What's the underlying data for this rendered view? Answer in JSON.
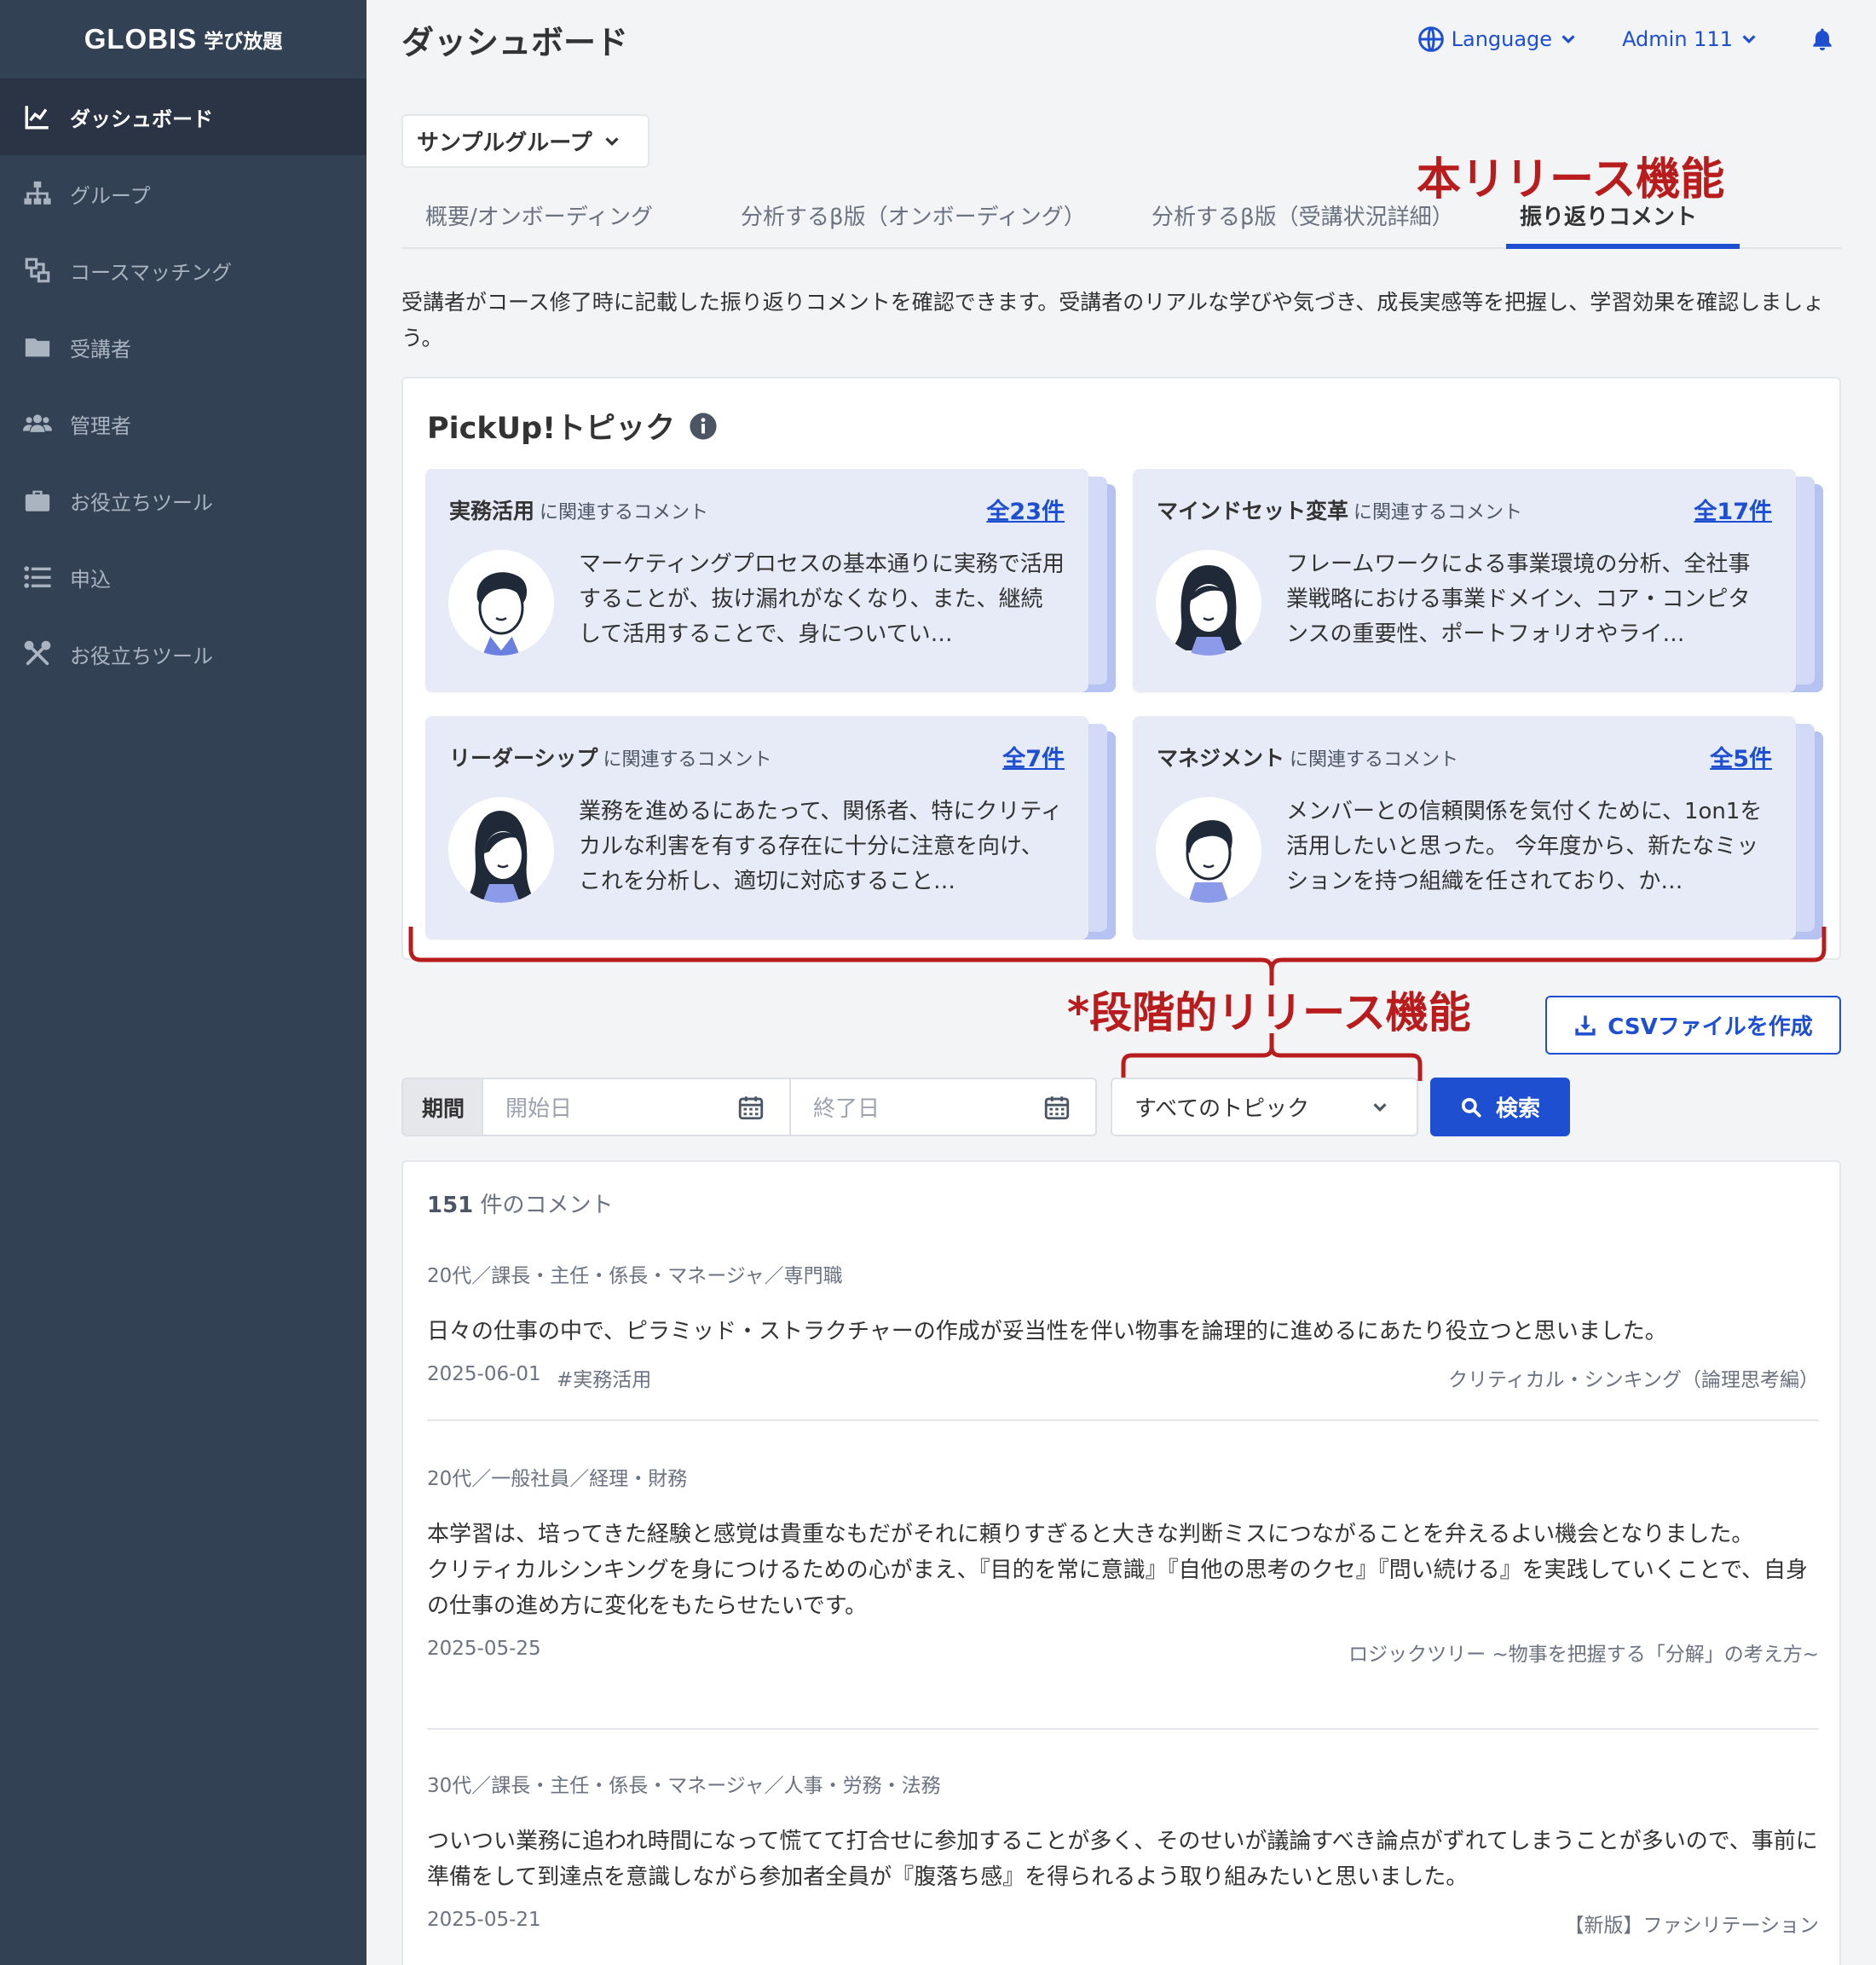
{
  "sidebar": {
    "logo_brand": "GLOBIS",
    "logo_sub": "学び放題",
    "items": [
      {
        "label": "ダッシュボード",
        "icon": "chart-line-icon",
        "active": true
      },
      {
        "label": "グループ",
        "icon": "sitemap-icon"
      },
      {
        "label": "コースマッチング",
        "icon": "matching-icon"
      },
      {
        "label": "受講者",
        "icon": "folder-icon"
      },
      {
        "label": "管理者",
        "icon": "users-icon"
      },
      {
        "label": "お役立ちツール",
        "icon": "briefcase-icon"
      },
      {
        "label": "申込",
        "icon": "list-icon"
      },
      {
        "label": "お役立ちツール",
        "icon": "tools-icon"
      }
    ]
  },
  "header": {
    "title": "ダッシュボード",
    "language": "Language",
    "user": "Admin 111"
  },
  "group_select": "サンプルグループ",
  "release_note": "本リリース機能",
  "tabs": [
    {
      "label": "概要/オンボーディング"
    },
    {
      "label": "分析するβ版（オンボーディング）"
    },
    {
      "label": "分析するβ版（受講状況詳細）"
    },
    {
      "label": "振り返りコメント",
      "active": true
    }
  ],
  "description": "受講者がコース修了時に記載した振り返りコメントを確認できます。受講者のリアルな学びや気づき、成長実感等を把握し、学習効果を確認しましょう。",
  "pickup": {
    "title": "PickUp!トピック",
    "related_suffix": "に関連するコメント",
    "cards": [
      {
        "topic": "実務活用",
        "count": "全23件",
        "text": "マーケティングプロセスの基本通りに実務で活用することが、抜け漏れがなくなり、また、継続して活用することで、身についてい…",
        "avatar": "man-avatar-icon"
      },
      {
        "topic": "マインドセット変革",
        "count": "全17件",
        "text": "フレームワークによる事業環境の分析、全社事業戦略における事業ドメイン、コア・コンピタンスの重要性、ポートフォリオやライ…",
        "avatar": "woman-avatar-icon"
      },
      {
        "topic": "リーダーシップ",
        "count": "全7件",
        "text": "業務を進めるにあたって、関係者、特にクリティカルな利害を有する存在に十分に注意を向け、これを分析し、適切に対応すること…",
        "avatar": "woman-avatar-icon"
      },
      {
        "topic": "マネジメント",
        "count": "全5件",
        "text": "メンバーとの信頼関係を気付くために、1on1を活用したいと思った。 今年度から、新たなミッションを持つ組織を任されており、か…",
        "avatar": "man-avatar-icon"
      }
    ]
  },
  "staged_release_note": "*段階的リリース機能",
  "csv_button": "CSVファイルを作成",
  "filters": {
    "period_label": "期間",
    "start_placeholder": "開始日",
    "end_placeholder": "終了日",
    "topic_select": "すべてのトピック",
    "search_button": "検索"
  },
  "comments": {
    "count": "151",
    "count_suffix": " 件のコメント",
    "items": [
      {
        "meta": "20代／課長・主任・係長・マネージャ／専門職",
        "body": "日々の仕事の中で、ピラミッド・ストラクチャーの作成が妥当性を伴い物事を論理的に進めるにあたり役立つと思いました。",
        "date": "2025-06-01",
        "tag": "#実務活用",
        "course": "クリティカル・シンキング（論理思考編）"
      },
      {
        "meta": "20代／一般社員／経理・財務",
        "body": "本学習は、培ってきた経験と感覚は貴重なもだがそれに頼りすぎると大きな判断ミスにつながることを弁えるよい機会となりました。\nクリティカルシンキングを身につけるための心がまえ、『目的を常に意識』『自他の思考のクセ』『問い続ける』を実践していくことで、自身の仕事の進め方に変化をもたらせたいです。",
        "date": "2025-05-25",
        "tag": "",
        "course": "ロジックツリー ~物事を把握する「分解」の考え方~"
      },
      {
        "meta": "30代／課長・主任・係長・マネージャ／人事・労務・法務",
        "body": "ついつい業務に追われ時間になって慌てて打合せに参加することが多く、そのせいが議論すべき論点がずれてしまうことが多いので、事前に準備をして到達点を意識しながら参加者全員が『腹落ち感』を得られるよう取り組みたいと思いました。",
        "date": "2025-05-21",
        "tag": "",
        "course": "【新版】ファシリテーション"
      }
    ]
  },
  "colors": {
    "sidebar": "#334155",
    "accent": "#1e4fd1",
    "annotation_red": "#b91c1c",
    "card_bg": "#e7ebf7"
  }
}
